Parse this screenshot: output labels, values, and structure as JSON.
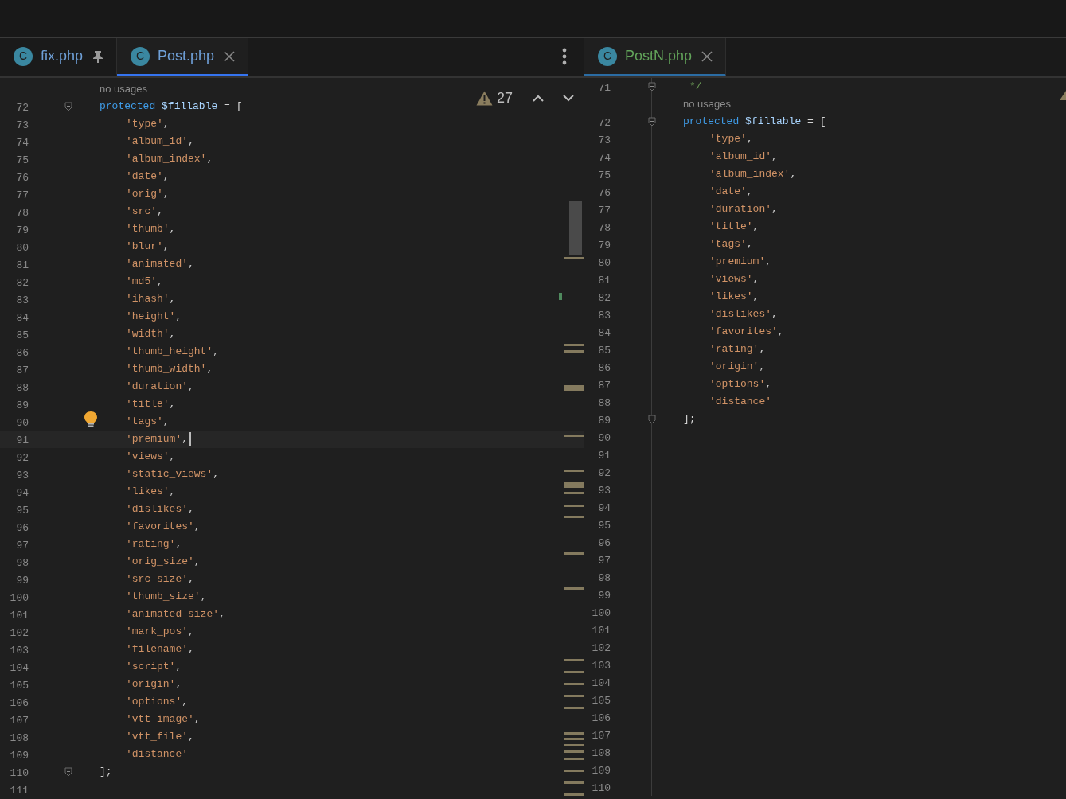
{
  "panes": [
    {
      "focused": true,
      "tabs": [
        {
          "icon_letter": "C",
          "label": "fix.php",
          "selected": false,
          "pinned": true
        },
        {
          "icon_letter": "C",
          "label": "Post.php",
          "selected": true,
          "pinned": false
        }
      ],
      "inspection": {
        "count": "27"
      },
      "lines": [
        {
          "kind": "hint",
          "text": "no usages",
          "fold": false,
          "current": false,
          "bulb": false
        },
        {
          "number": "72",
          "kind": "decl",
          "keyword": "protected",
          "variable": "$fillable",
          "text": "= [",
          "fold": true,
          "current": false,
          "bulb": false
        },
        {
          "number": "73",
          "kind": "item",
          "text": "'type'",
          "suffix": ",",
          "fold": false,
          "current": false,
          "bulb": false
        },
        {
          "number": "74",
          "kind": "item",
          "text": "'album_id'",
          "suffix": ",",
          "fold": false,
          "current": false,
          "bulb": false
        },
        {
          "number": "75",
          "kind": "item",
          "text": "'album_index'",
          "suffix": ",",
          "fold": false,
          "current": false,
          "bulb": false
        },
        {
          "number": "76",
          "kind": "item",
          "text": "'date'",
          "suffix": ",",
          "fold": false,
          "current": false,
          "bulb": false
        },
        {
          "number": "77",
          "kind": "item",
          "text": "'orig'",
          "suffix": ",",
          "fold": false,
          "current": false,
          "bulb": false
        },
        {
          "number": "78",
          "kind": "item",
          "text": "'src'",
          "suffix": ",",
          "fold": false,
          "current": false,
          "bulb": false
        },
        {
          "number": "79",
          "kind": "item",
          "text": "'thumb'",
          "suffix": ",",
          "fold": false,
          "current": false,
          "bulb": false
        },
        {
          "number": "80",
          "kind": "item",
          "text": "'blur'",
          "suffix": ",",
          "fold": false,
          "current": false,
          "bulb": false
        },
        {
          "number": "81",
          "kind": "item",
          "text": "'animated'",
          "suffix": ",",
          "fold": false,
          "current": false,
          "bulb": false
        },
        {
          "number": "82",
          "kind": "item",
          "text": "'md5'",
          "suffix": ",",
          "fold": false,
          "current": false,
          "bulb": false
        },
        {
          "number": "83",
          "kind": "item",
          "text": "'ihash'",
          "suffix": ",",
          "fold": false,
          "current": false,
          "bulb": false
        },
        {
          "number": "84",
          "kind": "item",
          "text": "'height'",
          "suffix": ",",
          "fold": false,
          "current": false,
          "bulb": false
        },
        {
          "number": "85",
          "kind": "item",
          "text": "'width'",
          "suffix": ",",
          "fold": false,
          "current": false,
          "bulb": false
        },
        {
          "number": "86",
          "kind": "item",
          "text": "'thumb_height'",
          "suffix": ",",
          "fold": false,
          "current": false,
          "bulb": false
        },
        {
          "number": "87",
          "kind": "item",
          "text": "'thumb_width'",
          "suffix": ",",
          "fold": false,
          "current": false,
          "bulb": false
        },
        {
          "number": "88",
          "kind": "item",
          "text": "'duration'",
          "suffix": ",",
          "fold": false,
          "current": false,
          "bulb": false
        },
        {
          "number": "89",
          "kind": "item",
          "text": "'title'",
          "suffix": ",",
          "fold": false,
          "current": false,
          "bulb": false
        },
        {
          "number": "90",
          "kind": "item",
          "text": "'tags'",
          "suffix": ",",
          "fold": false,
          "current": false,
          "bulb": true
        },
        {
          "number": "91",
          "kind": "item",
          "text": "'premium'",
          "suffix": ",",
          "fold": false,
          "current": true,
          "bulb": false
        },
        {
          "number": "92",
          "kind": "item",
          "text": "'views'",
          "suffix": ",",
          "fold": false,
          "current": false,
          "bulb": false
        },
        {
          "number": "93",
          "kind": "item",
          "text": "'static_views'",
          "suffix": ",",
          "fold": false,
          "current": false,
          "bulb": false
        },
        {
          "number": "94",
          "kind": "item",
          "text": "'likes'",
          "suffix": ",",
          "fold": false,
          "current": false,
          "bulb": false
        },
        {
          "number": "95",
          "kind": "item",
          "text": "'dislikes'",
          "suffix": ",",
          "fold": false,
          "current": false,
          "bulb": false
        },
        {
          "number": "96",
          "kind": "item",
          "text": "'favorites'",
          "suffix": ",",
          "fold": false,
          "current": false,
          "bulb": false
        },
        {
          "number": "97",
          "kind": "item",
          "text": "'rating'",
          "suffix": ",",
          "fold": false,
          "current": false,
          "bulb": false
        },
        {
          "number": "98",
          "kind": "item",
          "text": "'orig_size'",
          "suffix": ",",
          "fold": false,
          "current": false,
          "bulb": false
        },
        {
          "number": "99",
          "kind": "item",
          "text": "'src_size'",
          "suffix": ",",
          "fold": false,
          "current": false,
          "bulb": false
        },
        {
          "number": "100",
          "kind": "item",
          "text": "'thumb_size'",
          "suffix": ",",
          "fold": false,
          "current": false,
          "bulb": false
        },
        {
          "number": "101",
          "kind": "item",
          "text": "'animated_size'",
          "suffix": ",",
          "fold": false,
          "current": false,
          "bulb": false
        },
        {
          "number": "102",
          "kind": "item",
          "text": "'mark_pos'",
          "suffix": ",",
          "fold": false,
          "current": false,
          "bulb": false
        },
        {
          "number": "103",
          "kind": "item",
          "text": "'filename'",
          "suffix": ",",
          "fold": false,
          "current": false,
          "bulb": false
        },
        {
          "number": "104",
          "kind": "item",
          "text": "'script'",
          "suffix": ",",
          "fold": false,
          "current": false,
          "bulb": false
        },
        {
          "number": "105",
          "kind": "item",
          "text": "'origin'",
          "suffix": ",",
          "fold": false,
          "current": false,
          "bulb": false
        },
        {
          "number": "106",
          "kind": "item",
          "text": "'options'",
          "suffix": ",",
          "fold": false,
          "current": false,
          "bulb": false
        },
        {
          "number": "107",
          "kind": "item",
          "text": "'vtt_image'",
          "suffix": ",",
          "fold": false,
          "current": false,
          "bulb": false
        },
        {
          "number": "108",
          "kind": "item",
          "text": "'vtt_file'",
          "suffix": ",",
          "fold": false,
          "current": false,
          "bulb": false
        },
        {
          "number": "109",
          "kind": "item",
          "text": "'distance'",
          "fold": false,
          "current": false,
          "bulb": false
        },
        {
          "number": "110",
          "kind": "plain",
          "text": "];",
          "fold": true,
          "current": false,
          "bulb": false
        },
        {
          "number": "111",
          "kind": "empty",
          "fold": false,
          "current": false,
          "bulb": false
        }
      ]
    },
    {
      "focused": false,
      "tabs": [
        {
          "icon_letter": "C",
          "label": "PostN.php",
          "selected": true,
          "pinned": false
        }
      ],
      "lines": [
        {
          "number": "71",
          "kind": "comment",
          "text": "*/",
          "fold": true,
          "current": false,
          "bulb": false
        },
        {
          "kind": "hint",
          "text": "no usages",
          "fold": false,
          "current": false,
          "bulb": false
        },
        {
          "number": "72",
          "kind": "decl",
          "keyword": "protected",
          "variable": "$fillable",
          "text": "= [",
          "fold": true,
          "current": false,
          "bulb": false
        },
        {
          "number": "73",
          "kind": "item",
          "text": "'type'",
          "suffix": ",",
          "fold": false,
          "current": false,
          "bulb": false
        },
        {
          "number": "74",
          "kind": "item",
          "text": "'album_id'",
          "suffix": ",",
          "fold": false,
          "current": false,
          "bulb": false
        },
        {
          "number": "75",
          "kind": "item",
          "text": "'album_index'",
          "suffix": ",",
          "fold": false,
          "current": false,
          "bulb": false
        },
        {
          "number": "76",
          "kind": "item",
          "text": "'date'",
          "suffix": ",",
          "fold": false,
          "current": false,
          "bulb": false
        },
        {
          "number": "77",
          "kind": "item",
          "text": "'duration'",
          "suffix": ",",
          "fold": false,
          "current": false,
          "bulb": false
        },
        {
          "number": "78",
          "kind": "item",
          "text": "'title'",
          "suffix": ",",
          "fold": false,
          "current": false,
          "bulb": false
        },
        {
          "number": "79",
          "kind": "item",
          "text": "'tags'",
          "suffix": ",",
          "fold": false,
          "current": false,
          "bulb": false
        },
        {
          "number": "80",
          "kind": "item",
          "text": "'premium'",
          "suffix": ",",
          "fold": false,
          "current": false,
          "bulb": false
        },
        {
          "number": "81",
          "kind": "item",
          "text": "'views'",
          "suffix": ",",
          "fold": false,
          "current": false,
          "bulb": false
        },
        {
          "number": "82",
          "kind": "item",
          "text": "'likes'",
          "suffix": ",",
          "fold": false,
          "current": false,
          "bulb": false
        },
        {
          "number": "83",
          "kind": "item",
          "text": "'dislikes'",
          "suffix": ",",
          "fold": false,
          "current": false,
          "bulb": false
        },
        {
          "number": "84",
          "kind": "item",
          "text": "'favorites'",
          "suffix": ",",
          "fold": false,
          "current": false,
          "bulb": false
        },
        {
          "number": "85",
          "kind": "item",
          "text": "'rating'",
          "suffix": ",",
          "fold": false,
          "current": false,
          "bulb": false
        },
        {
          "number": "86",
          "kind": "item",
          "text": "'origin'",
          "suffix": ",",
          "fold": false,
          "current": false,
          "bulb": false
        },
        {
          "number": "87",
          "kind": "item",
          "text": "'options'",
          "suffix": ",",
          "fold": false,
          "current": false,
          "bulb": false
        },
        {
          "number": "88",
          "kind": "item",
          "text": "'distance'",
          "fold": false,
          "current": false,
          "bulb": false
        },
        {
          "number": "89",
          "kind": "plain",
          "text": "];",
          "fold": true,
          "current": false,
          "bulb": false
        },
        {
          "number": "90",
          "kind": "empty",
          "fold": false,
          "current": false,
          "bulb": false
        },
        {
          "number": "91",
          "kind": "empty",
          "fold": false,
          "current": false,
          "bulb": false
        },
        {
          "number": "92",
          "kind": "empty",
          "fold": false,
          "current": false,
          "bulb": false
        },
        {
          "number": "93",
          "kind": "empty",
          "fold": false,
          "current": false,
          "bulb": false
        },
        {
          "number": "94",
          "kind": "empty",
          "fold": false,
          "current": false,
          "bulb": false
        },
        {
          "number": "95",
          "kind": "empty",
          "fold": false,
          "current": false,
          "bulb": false
        },
        {
          "number": "96",
          "kind": "empty",
          "fold": false,
          "current": false,
          "bulb": false
        },
        {
          "number": "97",
          "kind": "empty",
          "fold": false,
          "current": false,
          "bulb": false
        },
        {
          "number": "98",
          "kind": "empty",
          "fold": false,
          "current": false,
          "bulb": false
        },
        {
          "number": "99",
          "kind": "empty",
          "fold": false,
          "current": false,
          "bulb": false
        },
        {
          "number": "100",
          "kind": "empty",
          "fold": false,
          "current": false,
          "bulb": false
        },
        {
          "number": "101",
          "kind": "empty",
          "fold": false,
          "current": false,
          "bulb": false
        },
        {
          "number": "102",
          "kind": "empty",
          "fold": false,
          "current": false,
          "bulb": false
        },
        {
          "number": "103",
          "kind": "empty",
          "fold": false,
          "current": false,
          "bulb": false
        },
        {
          "number": "104",
          "kind": "empty",
          "fold": false,
          "current": false,
          "bulb": false
        },
        {
          "number": "105",
          "kind": "empty",
          "fold": false,
          "current": false,
          "bulb": false
        },
        {
          "number": "106",
          "kind": "empty",
          "fold": false,
          "current": false,
          "bulb": false
        },
        {
          "number": "107",
          "kind": "empty",
          "fold": false,
          "current": false,
          "bulb": false
        },
        {
          "number": "108",
          "kind": "empty",
          "fold": false,
          "current": false,
          "bulb": false
        },
        {
          "number": "109",
          "kind": "empty",
          "fold": false,
          "current": false,
          "bulb": false
        },
        {
          "number": "110",
          "kind": "empty",
          "fold": false,
          "current": false,
          "bulb": false
        }
      ]
    }
  ]
}
